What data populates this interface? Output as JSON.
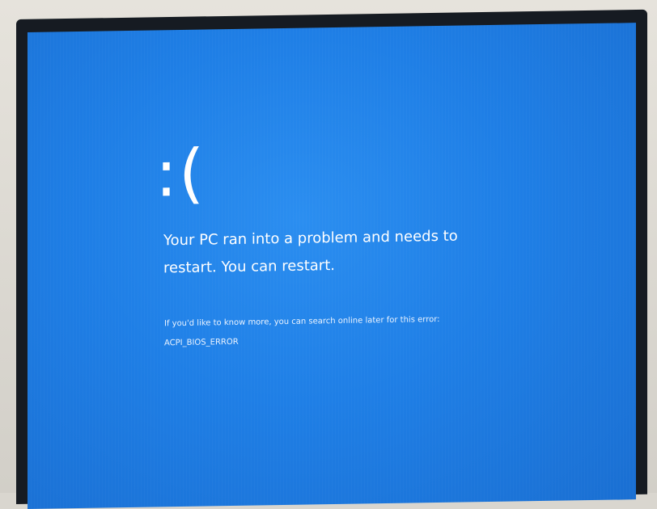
{
  "bsod": {
    "emoticon": ":(",
    "headline_line1": "Your PC ran into a problem and needs to",
    "headline_line2": "restart. You can restart.",
    "info_text": "If you'd like to know more, you can search online later for this error:",
    "stop_code": "ACPI_BIOS_ERROR"
  },
  "colors": {
    "screen_blue": "#1f7fe6",
    "text": "#ffffff"
  }
}
